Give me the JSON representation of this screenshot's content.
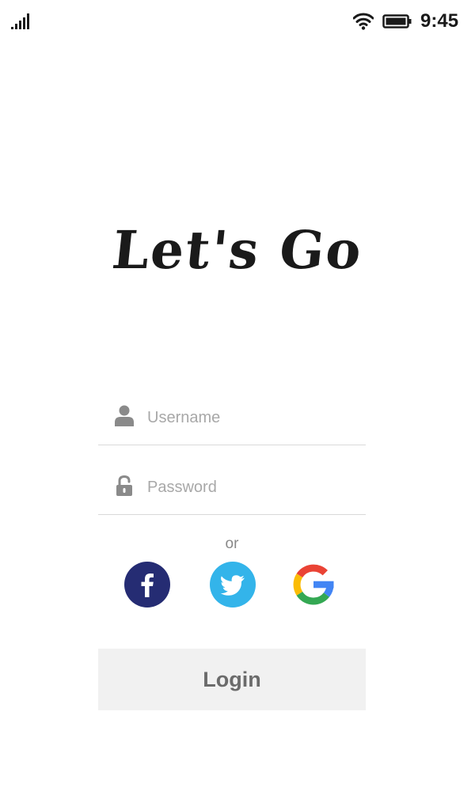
{
  "status_bar": {
    "time": "9:45",
    "signal_icon": "signal-bars-icon",
    "wifi_icon": "wifi-icon",
    "battery_icon": "battery-icon"
  },
  "app": {
    "logo_text": "Let's Go"
  },
  "form": {
    "username": {
      "placeholder": "Username",
      "value": "",
      "icon": "person-icon"
    },
    "password": {
      "placeholder": "Password",
      "value": "",
      "icon": "lock-icon"
    },
    "or_label": "or",
    "social": [
      {
        "name": "facebook",
        "icon": "facebook-icon",
        "color": "#252c73"
      },
      {
        "name": "twitter",
        "icon": "twitter-icon",
        "color": "#33b4ea"
      },
      {
        "name": "google",
        "icon": "google-icon",
        "colors": [
          "#ea4335",
          "#fbbc05",
          "#34a853",
          "#4285f4"
        ]
      }
    ],
    "login_label": "Login"
  },
  "colors": {
    "background": "#ffffff",
    "icon_gray": "#8a8a8a",
    "placeholder": "#a8a8a8",
    "divider": "#d9d9d9",
    "button_bg": "#f1f1f1",
    "button_text": "#6b6b6b"
  }
}
